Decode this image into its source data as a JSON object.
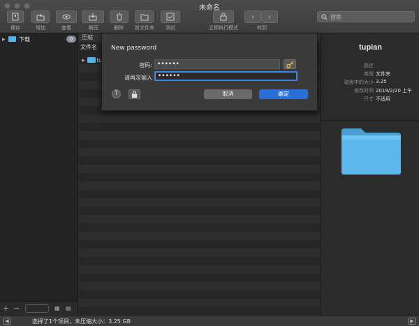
{
  "window": {
    "title": "未命名"
  },
  "toolbar": {
    "buttons": [
      {
        "label": "保存",
        "icon": "archive-save-icon"
      },
      {
        "label": "增加",
        "icon": "folder-add-icon"
      },
      {
        "label": "查看",
        "icon": "eye-icon"
      },
      {
        "label": "解压",
        "icon": "extract-icon"
      },
      {
        "label": "删除",
        "icon": "trash-icon"
      },
      {
        "label": "新文件夹",
        "icon": "new-folder-icon"
      },
      {
        "label": "测试",
        "icon": "check-icon"
      },
      {
        "label": "立即执行模式",
        "icon": "instant-mode-icon"
      },
      {
        "label": "转到",
        "icon": "nav-arrows-icon"
      }
    ],
    "search_placeholder": "搜索"
  },
  "sidebar": {
    "items": [
      {
        "label": "下载",
        "badge": "0"
      }
    ]
  },
  "file_list": {
    "header_tab": "压缩",
    "column_header": "文件名",
    "rows": [
      {
        "name": "tupian"
      }
    ]
  },
  "inspector": {
    "name": "tupian",
    "fields": [
      {
        "key": "路径",
        "value": ""
      },
      {
        "key": "类型",
        "value": "文件夹"
      },
      {
        "key": "磁盘中的大小",
        "value": "3.25"
      },
      {
        "key": "修改时间",
        "value": "2019/2/20 上午"
      },
      {
        "key": "尺寸",
        "value": "不适用"
      }
    ]
  },
  "dialog": {
    "title": "New password",
    "password_label": "密码:",
    "password_value": "••••••",
    "confirm_label": "请再次输入",
    "confirm_value": "••••••",
    "cancel_label": "取消",
    "ok_label": "确定"
  },
  "statusbar": {
    "text": "选择了1个项目，未压缩大小：3.25 GB"
  },
  "colors": {
    "accent": "#2a6fd6",
    "folder": "#54b3e8"
  }
}
